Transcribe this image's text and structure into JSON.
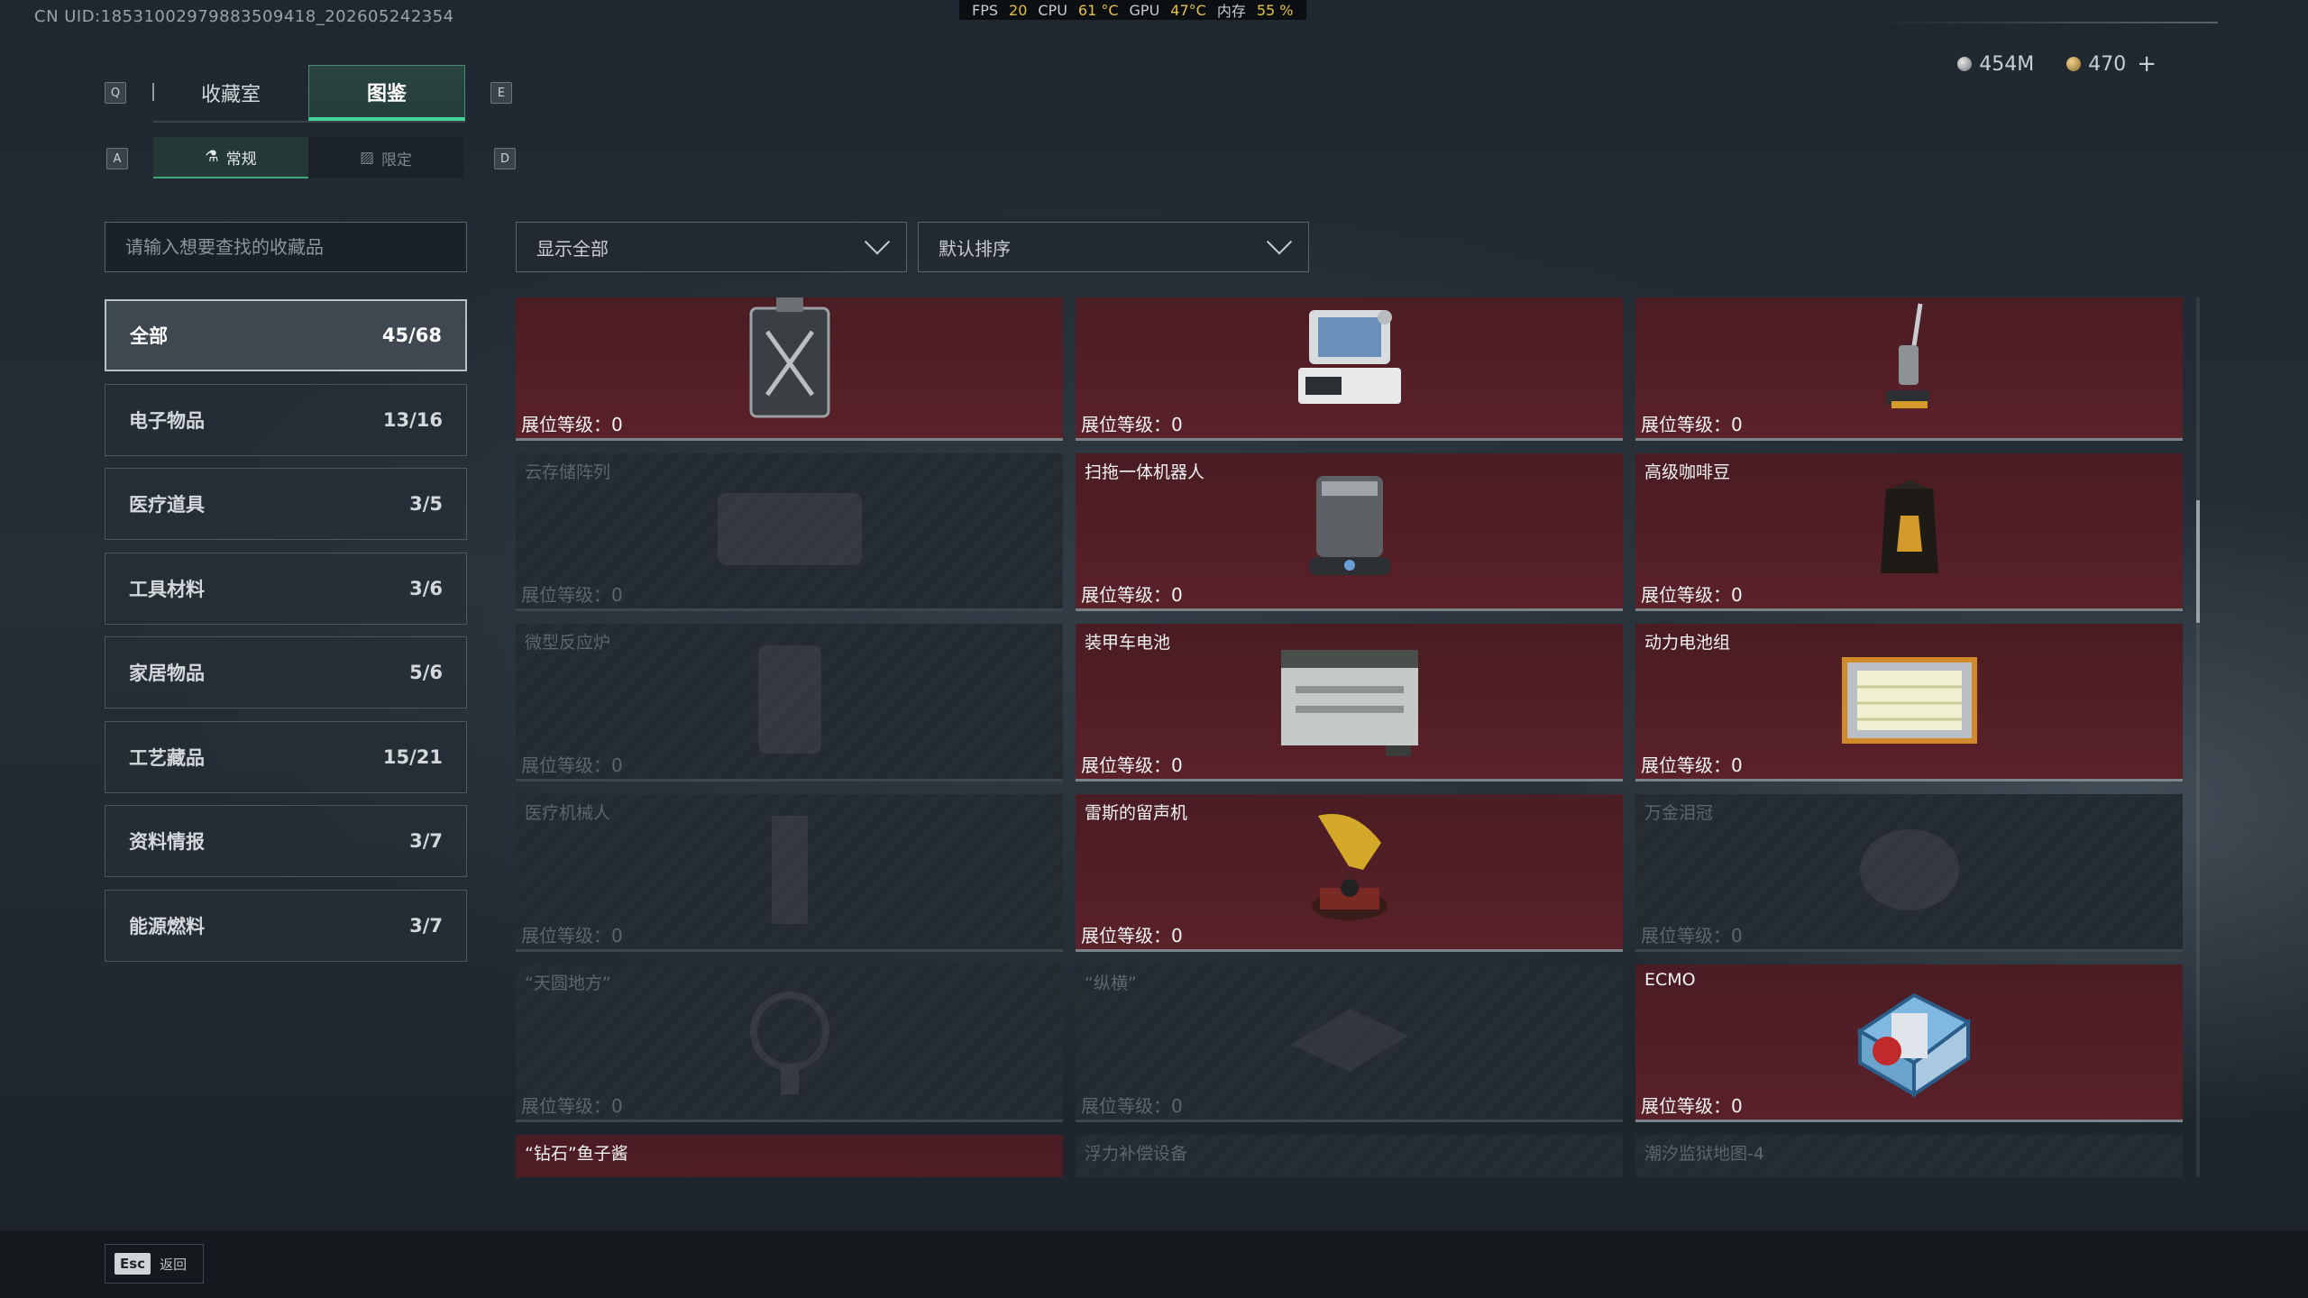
{
  "uid": "CN UID:18531002979883509418_202605242354",
  "stats": [
    {
      "label": "FPS",
      "value": "20"
    },
    {
      "label": "CPU",
      "value": "61 °C"
    },
    {
      "label": "GPU",
      "value": "47°C"
    },
    {
      "label": "内存",
      "value": "55 %"
    }
  ],
  "currency": {
    "silver": "454M",
    "gold": "470",
    "add": "+"
  },
  "keys": {
    "prev_tab": "Q",
    "next_tab": "E",
    "prev_sub": "A",
    "next_sub": "D"
  },
  "tabs": [
    "收藏室",
    "图鉴"
  ],
  "subtabs": [
    "常规",
    "限定"
  ],
  "search": {
    "placeholder": "请输入想要查找的收藏品"
  },
  "filters": {
    "show": "显示全部",
    "sort": "默认排序"
  },
  "categories": [
    {
      "label": "全部",
      "count": "45/68"
    },
    {
      "label": "电子物品",
      "count": "13/16"
    },
    {
      "label": "医疗道具",
      "count": "3/5"
    },
    {
      "label": "工具材料",
      "count": "3/6"
    },
    {
      "label": "家居物品",
      "count": "5/6"
    },
    {
      "label": "工艺藏品",
      "count": "15/21"
    },
    {
      "label": "资料情报",
      "count": "3/7"
    },
    {
      "label": "能源燃料",
      "count": "3/7"
    }
  ],
  "items": [
    {
      "name": "",
      "level": "展位等级：0",
      "owned": true,
      "icon": "jerrycan-icon"
    },
    {
      "name": "",
      "level": "展位等级：0",
      "owned": true,
      "icon": "medical-monitor-icon"
    },
    {
      "name": "",
      "level": "展位等级：0",
      "owned": true,
      "icon": "floor-washer-icon"
    },
    {
      "name": "云存储阵列",
      "level": "展位等级：0",
      "owned": false,
      "icon": "storage-array-icon"
    },
    {
      "name": "扫拖一体机器人",
      "level": "展位等级：0",
      "owned": true,
      "icon": "robot-vacuum-icon"
    },
    {
      "name": "高级咖啡豆",
      "level": "展位等级：0",
      "owned": true,
      "icon": "coffee-bag-icon"
    },
    {
      "name": "微型反应炉",
      "level": "展位等级：0",
      "owned": false,
      "icon": "reactor-icon"
    },
    {
      "name": "装甲车电池",
      "level": "展位等级：0",
      "owned": true,
      "icon": "car-battery-icon"
    },
    {
      "name": "动力电池组",
      "level": "展位等级：0",
      "owned": true,
      "icon": "battery-pack-icon"
    },
    {
      "name": "医疗机械人",
      "level": "展位等级：0",
      "owned": false,
      "icon": "medical-robot-icon"
    },
    {
      "name": "雷斯的留声机",
      "level": "展位等级：0",
      "owned": true,
      "icon": "gramophone-icon"
    },
    {
      "name": "万金泪冠",
      "level": "展位等级：0",
      "owned": false,
      "icon": "crown-icon"
    },
    {
      "name": "“天圆地方”",
      "level": "展位等级：0",
      "owned": false,
      "icon": "armillary-icon"
    },
    {
      "name": "“纵横”",
      "level": "展位等级：0",
      "owned": false,
      "icon": "board-icon"
    },
    {
      "name": "ECMO",
      "level": "展位等级：0",
      "owned": true,
      "icon": "ecmo-icon"
    },
    {
      "name": "“钻石”鱼子酱",
      "level": "",
      "owned": true,
      "icon": "caviar-icon"
    },
    {
      "name": "浮力补偿设备",
      "level": "",
      "owned": false,
      "icon": "bcd-icon"
    },
    {
      "name": "潮汐监狱地图-4",
      "level": "",
      "owned": false,
      "icon": "map-icon"
    }
  ],
  "footer": {
    "esc": "Esc",
    "back": "返回"
  },
  "colors": {
    "accent": "#42d39b",
    "owned_card": "#551f27",
    "locked_card": "#242b31"
  }
}
